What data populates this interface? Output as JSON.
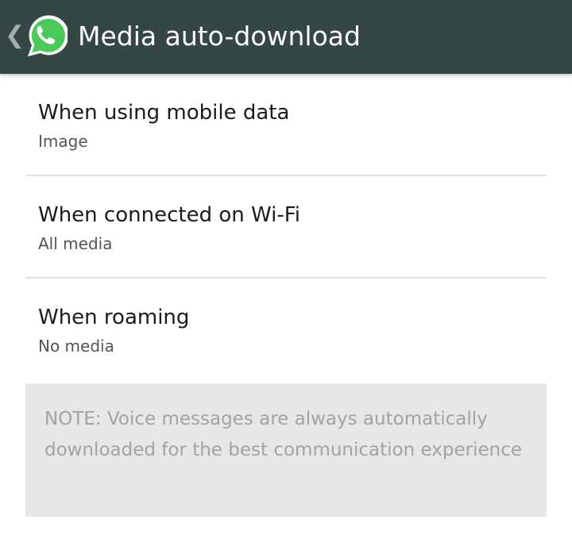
{
  "action_bar": {
    "title": "Media auto-download",
    "back_icon": "back-chevron-icon",
    "logo_icon": "whatsapp-logo-icon",
    "background_color": "#344744",
    "logo_color": "#4ac959"
  },
  "settings": [
    {
      "title": "When using mobile data",
      "summary": "Image"
    },
    {
      "title": "When connected on Wi-Fi",
      "summary": "All media"
    },
    {
      "title": "When roaming",
      "summary": "No media"
    }
  ],
  "note": {
    "text": "NOTE: Voice messages are always automatically downloaded for the best communication experience"
  }
}
